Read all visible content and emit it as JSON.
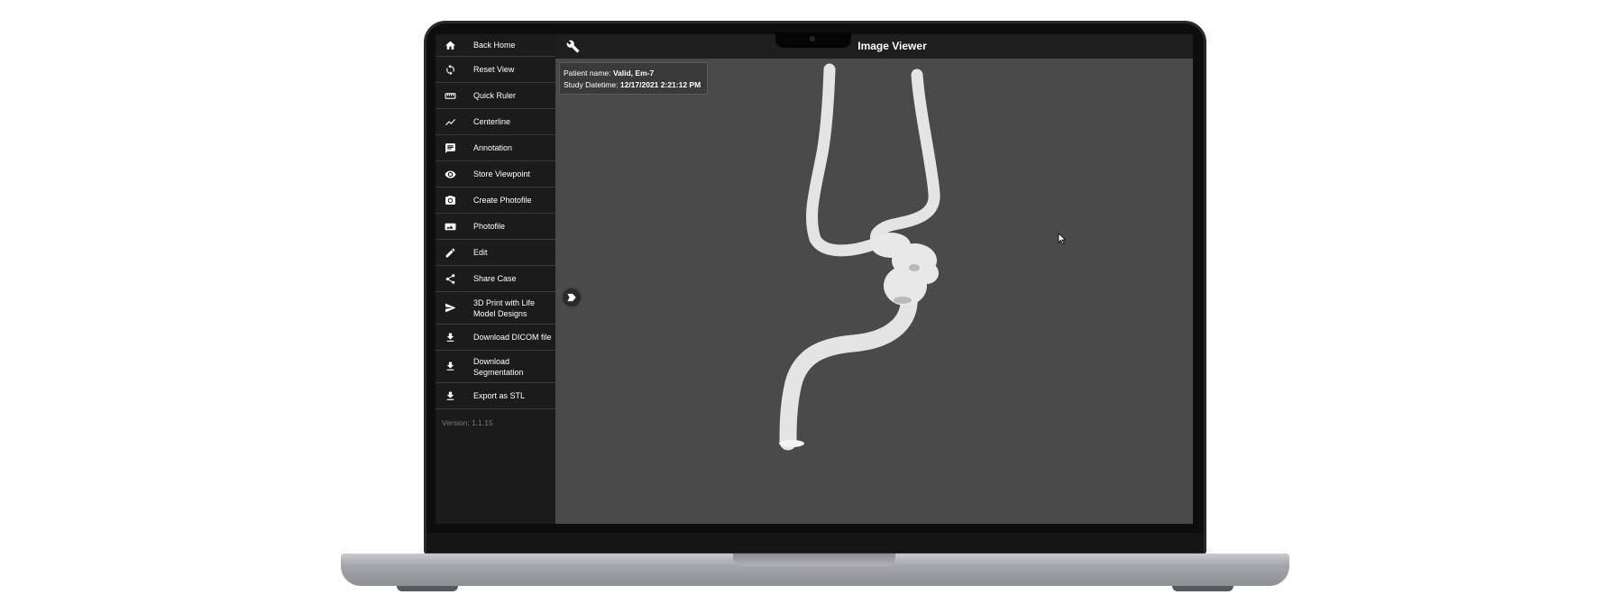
{
  "app": {
    "title": "Image Viewer",
    "version": "Version: 1.1.15"
  },
  "patient_info": {
    "name_label": "Patient name:",
    "name_value": "Valid, Em-7",
    "datetime_label": "Study Datetime:",
    "datetime_value": "12/17/2021 2:21:12 PM"
  },
  "sidebar": {
    "items": [
      {
        "label": "Back Home",
        "icon": "home-icon"
      },
      {
        "label": "Reset View",
        "icon": "refresh-icon"
      },
      {
        "label": "Quick Ruler",
        "icon": "ruler-icon"
      },
      {
        "label": "Centerline",
        "icon": "line-chart-icon"
      },
      {
        "label": "Annotation",
        "icon": "comment-icon"
      },
      {
        "label": "Store Viewpoint",
        "icon": "eye-icon"
      },
      {
        "label": "Create Photofile",
        "icon": "camera-icon"
      },
      {
        "label": "Photofile",
        "icon": "image-icon"
      },
      {
        "label": "Edit",
        "icon": "pencil-icon"
      },
      {
        "label": "Share Case",
        "icon": "share-icon"
      },
      {
        "label": "3D Print with Life Model Designs",
        "icon": "send-icon"
      },
      {
        "label": "Download DICOM file",
        "icon": "download-icon"
      },
      {
        "label": "Download Segmentation",
        "icon": "download-icon"
      },
      {
        "label": "Export as STL",
        "icon": "download-icon"
      }
    ]
  },
  "toolbar": {
    "tools_icon": "wrench-icon"
  },
  "colors": {
    "sidebar_bg": "#1b1b1b",
    "viewport_bg": "#4a4a4a",
    "vessel": "#e6e6e6"
  }
}
